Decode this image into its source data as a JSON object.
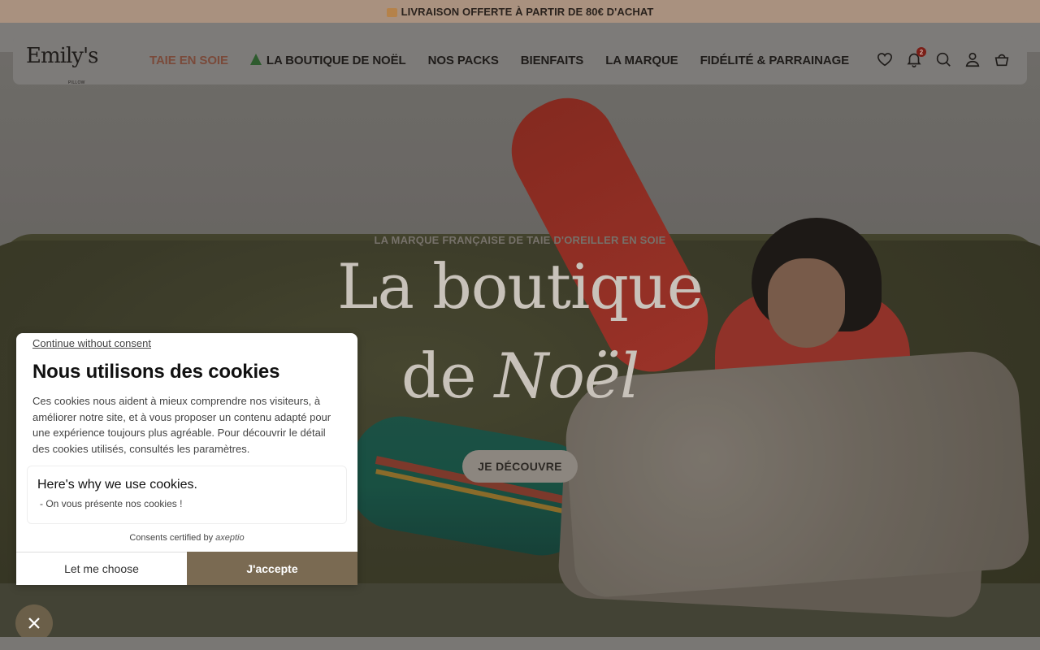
{
  "announcement": {
    "text": "LIVRAISON OFFERTE À PARTIR DE 80€ D'ACHAT",
    "icon": "package-icon"
  },
  "header": {
    "logo": "Emily's",
    "logo_sub": "PILLOW",
    "nav": [
      {
        "label": "TAIE EN SOIE",
        "active": true
      },
      {
        "label": "LA BOUTIQUE DE NOËL",
        "icon": "tree-icon"
      },
      {
        "label": "NOS PACKS"
      },
      {
        "label": "BIENFAITS"
      },
      {
        "label": "LA MARQUE"
      },
      {
        "label": "FIDÉLITÉ & PARRAINAGE"
      }
    ],
    "icons": [
      "heart-icon",
      "bell-icon",
      "search-icon",
      "user-icon",
      "bag-icon"
    ],
    "notification_count": "2"
  },
  "hero": {
    "kicker": "LA MARQUE FRANÇAISE DE TAIE D'OREILLER EN SOIE",
    "title_line1": "La boutique",
    "title_line2_a": "de ",
    "title_line2_b": "Noël",
    "cta": "JE DÉCOUVRE"
  },
  "cookie": {
    "skip": "Continue without consent",
    "title": "Nous utilisons des cookies",
    "body": "Ces cookies nous aident à mieux comprendre nos visiteurs, à améliorer notre site, et à vous proposer un contenu adapté pour une expérience toujours plus agréable. Pour découvrir le détail des cookies utilisés, consultés les paramètres.",
    "card_title": "Here's why we use cookies.",
    "card_sub": "- On vous présente nos cookies !",
    "certified": "Consents certified by",
    "certified_brand": "axeptio",
    "choose": "Let me choose",
    "accept": "J'accepte"
  },
  "colors": {
    "accent": "#7a6a52",
    "announce_bg": "#a9917f",
    "active_nav": "#7a4a3a"
  }
}
